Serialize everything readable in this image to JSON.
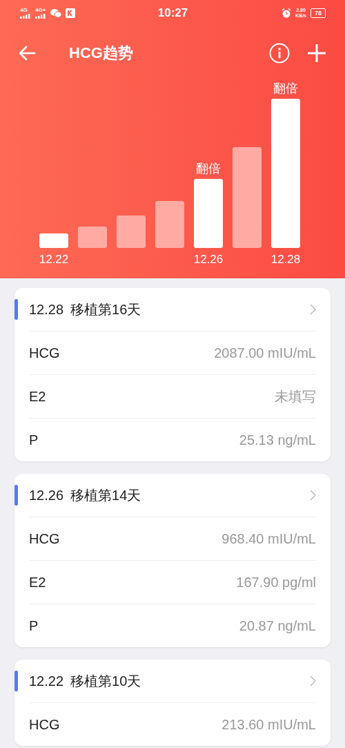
{
  "status_bar": {
    "network_1": "4G",
    "network_2": "4G+",
    "time": "10:27",
    "speed": "2.80",
    "speed_unit": "KB/s",
    "battery": "78"
  },
  "header": {
    "title": "HCG趋势"
  },
  "trend": {
    "bars": [
      {
        "label": "12.22",
        "highlighted": true
      },
      {
        "highlighted": false
      },
      {
        "highlighted": false
      },
      {
        "highlighted": false
      },
      {
        "label": "12.26",
        "note": "翻倍",
        "highlighted": true
      },
      {
        "highlighted": false
      },
      {
        "label": "12.28",
        "note": "翻倍",
        "highlighted": true
      }
    ]
  },
  "records": [
    {
      "date": "12.28",
      "title": "移植第16天",
      "items": [
        {
          "name": "HCG",
          "value": "2087.00 mIU/mL"
        },
        {
          "name": "E2",
          "value": "未填写"
        },
        {
          "name": "P",
          "value": "25.13 ng/mL"
        }
      ]
    },
    {
      "date": "12.26",
      "title": "移植第14天",
      "items": [
        {
          "name": "HCG",
          "value": "968.40 mIU/mL"
        },
        {
          "name": "E2",
          "value": "167.90 pg/ml"
        },
        {
          "name": "P",
          "value": "20.87 ng/mL"
        }
      ]
    },
    {
      "date": "12.22",
      "title": "移植第10天",
      "items": [
        {
          "name": "HCG",
          "value": "213.60 mIU/mL"
        }
      ]
    }
  ]
}
